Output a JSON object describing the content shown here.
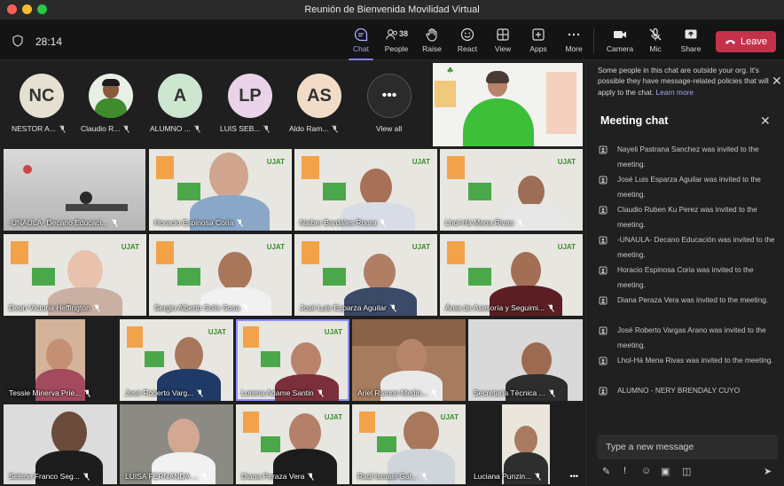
{
  "window": {
    "title": "Reunión de Bienvenida Movilidad Virtual"
  },
  "toolbar": {
    "timer": "28:14",
    "chat_label": "Chat",
    "people_label": "People",
    "people_count": "38",
    "raise_label": "Raise",
    "react_label": "React",
    "view_label": "View",
    "apps_label": "Apps",
    "more_label": "More",
    "camera_label": "Camera",
    "mic_label": "Mic",
    "share_label": "Share",
    "leave_label": "Leave",
    "leave_color": "#c4314b"
  },
  "strip": {
    "participants": [
      {
        "initials": "NC",
        "name": "NESTOR A...",
        "color": "#e6e0d2"
      },
      {
        "initials": "",
        "name": "Claudio R...",
        "color": "#cfe3c6"
      },
      {
        "initials": "A",
        "name": "ALUMNO ...",
        "color": "#cde6d0"
      },
      {
        "initials": "LP",
        "name": "LUIS SEB...",
        "color": "#ead3e8"
      },
      {
        "initials": "AS",
        "name": "Aldo Ram...",
        "color": "#f2dcc8"
      }
    ],
    "view_all_label": "View all"
  },
  "tiles": [
    {
      "name": "-UNAULA- Decano Educaci..."
    },
    {
      "name": "Horacio Espinosa Coria"
    },
    {
      "name": "Naiber Bardales Roura"
    },
    {
      "name": "Lhol-Há Mena Rivas"
    },
    {
      "name": "Deon Victoria Heffington"
    },
    {
      "name": "Sergio Alberto Solís Sosa"
    },
    {
      "name": "José Luis Esparza Aguilar"
    },
    {
      "name": "Área de Asesoría y Seguimi..."
    },
    {
      "name": "Tessie Minerva Prie..."
    },
    {
      "name": "José Roberto Varg..."
    },
    {
      "name": "Lorena Adame Santin"
    },
    {
      "name": "Ariel Ramon Medin..."
    },
    {
      "name": "Secretaría Técnica ..."
    },
    {
      "name": "Selene Franco Seg..."
    },
    {
      "name": "LUISA FERNANDA ..."
    },
    {
      "name": "Diana Peraza Vera"
    },
    {
      "name": "Raúl Ismael Gal..."
    },
    {
      "name": "Luciana Punzin..."
    }
  ],
  "chat": {
    "notice": "Some people in this chat are outside your org. It's possible they have message-related policies that will apply to the chat.",
    "learn_more": "Learn more",
    "header": "Meeting chat",
    "messages": [
      "Nayeli Pastrana Sanchez was invited to the meeting.",
      "José Luis Esparza Aguilar was invited to the meeting.",
      "Claudio Ruben Ku Perez was invited to the meeting.",
      "-UNAULA- Decano Educación was invited to the meeting.",
      "Horacio Espinosa Coria was invited to the meeting.",
      "Diana Peraza Vera was invited to the meeting.",
      "José Roberto Vargas Arano was invited to the meeting.",
      "Lhol-Há Mena Rivas was invited to the meeting.",
      "ALUMNO - NERY BRENDALY CUYO"
    ],
    "compose_placeholder": "Type a new message"
  },
  "accent_color": "#7f85f5"
}
